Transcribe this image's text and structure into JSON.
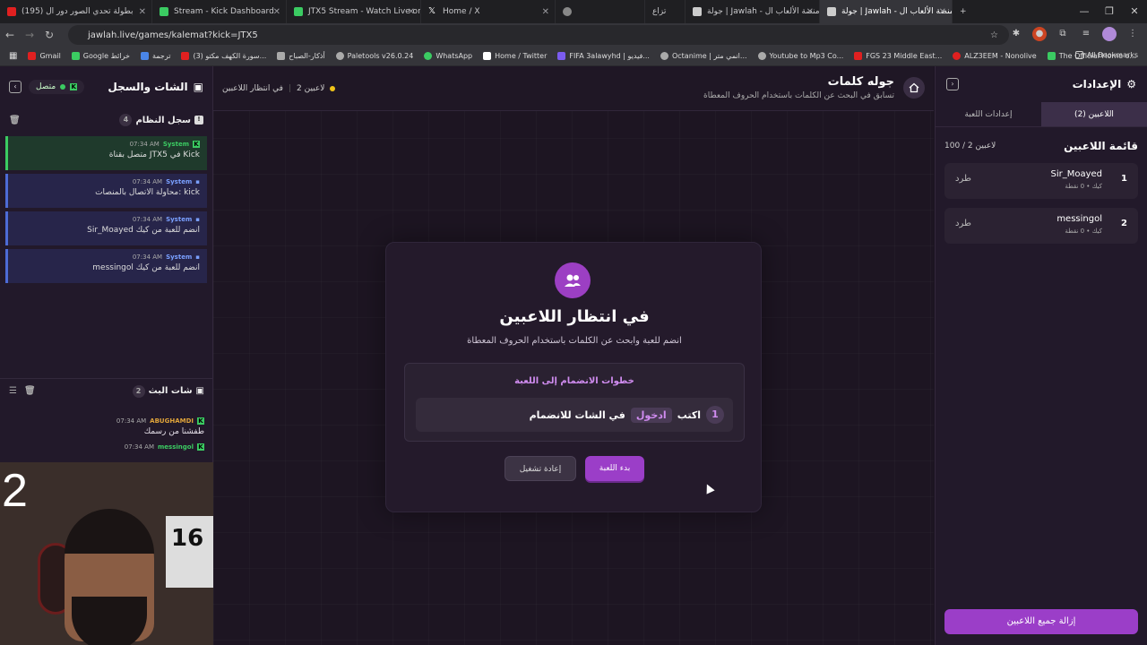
{
  "browser": {
    "tabs": [
      {
        "label": "(195) بطولة تحدي الصور دور ال",
        "color": "#e02020"
      },
      {
        "label": "Stream - Kick Dashboard",
        "color": "#3bcb62"
      },
      {
        "label": "JTX5 Stream - Watch Live on Ki",
        "color": "#3bcb62"
      },
      {
        "label": "Home / X",
        "color": "#ffffff"
      },
      {
        "label": "",
        "color": "#888888"
      },
      {
        "label": "تزاع",
        "color": "#888888"
      },
      {
        "label": "جولة | Jawlah - منصة الألعاب ال",
        "color": "#cccccc"
      },
      {
        "label": "جولة | Jawlah - منصة الألعاب ال",
        "color": "#cccccc"
      }
    ],
    "url": "jawlah.live/games/kalemat?kick=JTX5",
    "bookmarks": [
      {
        "label": "Gmail",
        "color": "#e02020"
      },
      {
        "label": "Google خرائط",
        "color": "#3bcb62"
      },
      {
        "label": "ترجمة",
        "color": "#4a86e8"
      },
      {
        "label": "(3) سورة الكهف مكتو...",
        "color": "#e02020"
      },
      {
        "label": "أذكار-الصباح",
        "color": "#aaaaaa"
      },
      {
        "label": "Paletools v26.0.24",
        "color": "#aaaaaa"
      },
      {
        "label": "WhatsApp",
        "color": "#3bcb62"
      },
      {
        "label": "Home / Twitter",
        "color": "#ffffff"
      },
      {
        "label": "FIFA 3alawyhd | فيديو...",
        "color": "#7b5cf0"
      },
      {
        "label": "Octanime | انمي متر...",
        "color": "#aaaaaa"
      },
      {
        "label": "Youtube to Mp3 Co...",
        "color": "#aaaaaa"
      },
      {
        "label": "FGS 23 Middle East...",
        "color": "#e02020"
      },
      {
        "label": "ALZ3EEM - Nonolive",
        "color": "#e02020"
      },
      {
        "label": "The Official Home o...",
        "color": "#3bcb62"
      }
    ],
    "all_bookmarks": "All Bookmarks"
  },
  "left": {
    "title": "الشات والسجل",
    "status": "متصل",
    "log_title": "سجل النظام",
    "log_count": "4",
    "log": [
      {
        "author": "System",
        "time": "07:34 AM",
        "text": "متصل بقناة JTX5 في Kick",
        "style": "green"
      },
      {
        "author": "System",
        "time": "07:34 AM",
        "text": "محاولة الاتصال بالمنصات: kick",
        "style": "blue"
      },
      {
        "author": "System",
        "time": "07:34 AM",
        "text": "Sir_Moayed انضم للعبة من كيك",
        "style": "blue"
      },
      {
        "author": "System",
        "time": "07:34 AM",
        "text": "messingol انضم للعبة من كيك",
        "style": "blue"
      }
    ],
    "chat_title": "شات البث",
    "chat_count": "2",
    "chat": [
      {
        "author": "ABUGHAMDI",
        "time": "07:34 AM",
        "text": "طفشنا من رسمك",
        "color": "#e0a43a"
      },
      {
        "author": "messingol",
        "time": "07:34 AM",
        "text": "",
        "color": "#3bcb62"
      }
    ],
    "webcam_number": "2",
    "jersey": "16"
  },
  "main": {
    "title": "جوله كلمات",
    "subtitle": "تسابق في البحث عن الكلمات باستخدام الحروف المعطاة",
    "players_count": "2 لاعبين",
    "waiting_label": "في انتظار اللاعبين",
    "card": {
      "title": "في انتظار اللاعبين",
      "subtitle": "انضم للعبة وابحث عن الكلمات باستخدام الحروف المعطاة",
      "steps_title": "خطوات الانضمام إلى اللعبة",
      "step_number": "1",
      "step_before": "اكتب",
      "step_keyword": "ادخول",
      "step_after": "في الشات للانضمام",
      "start_button": "بدء اللعبة",
      "reset_button": "إعادة تشغيل"
    }
  },
  "right": {
    "title": "الإعدادات",
    "tab_players": "اللاعبين (2)",
    "tab_settings": "إعدادات اللعبة",
    "list_title": "قائمة اللاعبين",
    "list_count": "100 / 2 لاعبين",
    "players": [
      {
        "rank": "1",
        "name": "Sir_Moayed",
        "meta": "كيك • 0 نقطة",
        "kick": "طرد"
      },
      {
        "rank": "2",
        "name": "messingol",
        "meta": "كيك • 0 نقطة",
        "kick": "طرد"
      }
    ],
    "remove_all": "إزالة جميع اللاعبين"
  },
  "colors": {
    "accent": "#9b3ec8",
    "online": "#3bcb62"
  }
}
